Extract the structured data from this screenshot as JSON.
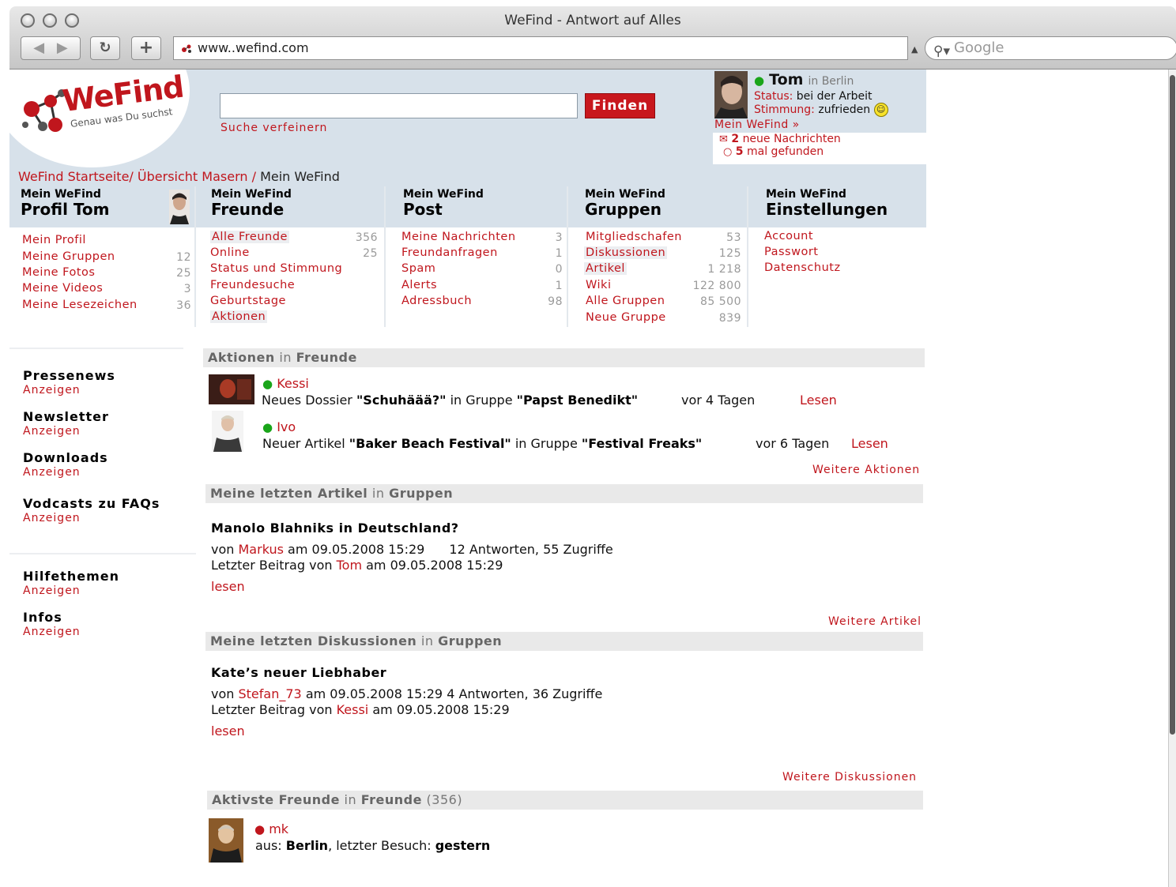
{
  "window": {
    "title": "WeFind - Antwort auf Alles"
  },
  "toolbar": {
    "url": "www..wefind.com",
    "search_placeholder": "Google"
  },
  "site": {
    "logo_text": "WeFind",
    "tagline": "Genau was Du suchst",
    "search_button": "Finden",
    "refine_link": "Suche verfeinern"
  },
  "profile": {
    "name": "Tom",
    "location": "in Berlin",
    "status_label": "Status:",
    "status_value": "bei der Arbeit",
    "mood_label": "Stimmung:",
    "mood_value": "zufrieden",
    "my_link": "Mein WeFind »",
    "messages_count": "2",
    "messages_label": "neue Nachrichten",
    "found_count": "5",
    "found_label": "mal gefunden"
  },
  "breadcrumb": {
    "part1": "WeFind Startseite/",
    "part2": "Übersicht Masern",
    "sep": "/",
    "current": "Mein WeFind"
  },
  "menus": [
    {
      "kicker": "Mein WeFind",
      "title": "Profil Tom",
      "items": [
        {
          "label": "Mein Profil",
          "count": ""
        },
        {
          "label": "Meine Gruppen",
          "count": "12"
        },
        {
          "label": "Meine Fotos",
          "count": "25"
        },
        {
          "label": "Meine Videos",
          "count": "3"
        },
        {
          "label": "Meine Lesezeichen",
          "count": "36"
        }
      ]
    },
    {
      "kicker": "Mein WeFind",
      "title": "Freunde",
      "items": [
        {
          "label": "Alle Freunde",
          "count": "356"
        },
        {
          "label": "Online",
          "count": "25"
        },
        {
          "label": "Status und Stimmung",
          "count": ""
        },
        {
          "label": "Freundesuche",
          "count": ""
        },
        {
          "label": "Geburtstage",
          "count": ""
        },
        {
          "label": "Aktionen",
          "count": ""
        }
      ]
    },
    {
      "kicker": "Mein WeFind",
      "title": "Post",
      "items": [
        {
          "label": "Meine Nachrichten",
          "count": "3"
        },
        {
          "label": "Freundanfragen",
          "count": "1"
        },
        {
          "label": "Spam",
          "count": "0"
        },
        {
          "label": "Alerts",
          "count": "1"
        },
        {
          "label": "Adressbuch",
          "count": "98"
        }
      ]
    },
    {
      "kicker": "Mein WeFind",
      "title": "Gruppen",
      "items": [
        {
          "label": "Mitgliedschafen",
          "count": "53"
        },
        {
          "label": "Diskussionen",
          "count": "125"
        },
        {
          "label": "Artikel",
          "count": "1 218"
        },
        {
          "label": "Wiki",
          "count": "122 800"
        },
        {
          "label": "Alle Gruppen",
          "count": "85 500"
        },
        {
          "label": "Neue Gruppe",
          "count": "839"
        }
      ]
    },
    {
      "kicker": "Mein WeFind",
      "title": "Einstellungen",
      "items": [
        {
          "label": "Account",
          "count": ""
        },
        {
          "label": "Passwort",
          "count": ""
        },
        {
          "label": "Datenschutz",
          "count": ""
        }
      ]
    }
  ],
  "sidebar": [
    {
      "title": "Pressenews",
      "link": "Anzeigen"
    },
    {
      "title": "Newsletter",
      "link": "Anzeigen"
    },
    {
      "title": "Downloads",
      "link": "Anzeigen"
    },
    {
      "title": "Vodcasts zu FAQs",
      "link": "Anzeigen"
    },
    {
      "title": "Hilfethemen",
      "link": "Anzeigen"
    },
    {
      "title": "Infos",
      "link": "Anzeigen"
    }
  ],
  "actions": {
    "head_bold": "Aktionen",
    "head_in": "in",
    "head_where": "Freunde",
    "items": [
      {
        "user": "Kessi",
        "prefix": "Neues Dossier",
        "item": "\"Schuhäää?\"",
        "mid": "in Gruppe",
        "group": "\"Papst Benedikt\"",
        "time": "vor 4 Tagen",
        "read": "Lesen"
      },
      {
        "user": "Ivo",
        "prefix": "Neuer Artikel",
        "item": "\"Baker Beach Festival\"",
        "mid": "in Gruppe",
        "group": "\"Festival Freaks\"",
        "time": "vor 6 Tagen",
        "read": "Lesen"
      }
    ],
    "more": "Weitere Aktionen"
  },
  "articles": {
    "head_bold": "Meine letzten Artikel",
    "head_in": "in",
    "head_where": "Gruppen",
    "title": "Manolo Blahniks in Deutschland?",
    "by": "von",
    "author": "Markus",
    "date": "am 09.05.2008 15:29",
    "stats": "12 Antworten, 55 Zugriffe",
    "last_label": "Letzter Beitrag von",
    "last_user": "Tom",
    "last_date": "am 09.05.2008 15:29",
    "read": "lesen",
    "more": "Weitere Artikel"
  },
  "discussions": {
    "head_bold": "Meine letzten Diskussionen",
    "head_in": "in",
    "head_where": "Gruppen",
    "title": "Kate’s neuer Liebhaber",
    "by": "von",
    "author": "Stefan_73",
    "date": "am 09.05.2008 15:29",
    "stats": "4 Antworten, 36 Zugriffe",
    "last_label": "Letzter Beitrag von",
    "last_user": "Kessi",
    "last_date": "am 09.05.2008 15:29",
    "read": "lesen",
    "more": "Weitere Diskussionen"
  },
  "friends": {
    "head_bold": "Aktivste Freunde",
    "head_in": "in",
    "head_where": "Freunde",
    "head_count": "(356)",
    "user": "mk",
    "from_label": "aus:",
    "city": "Berlin",
    "visit_label": ", letzter Besuch:",
    "visit": "gestern"
  }
}
